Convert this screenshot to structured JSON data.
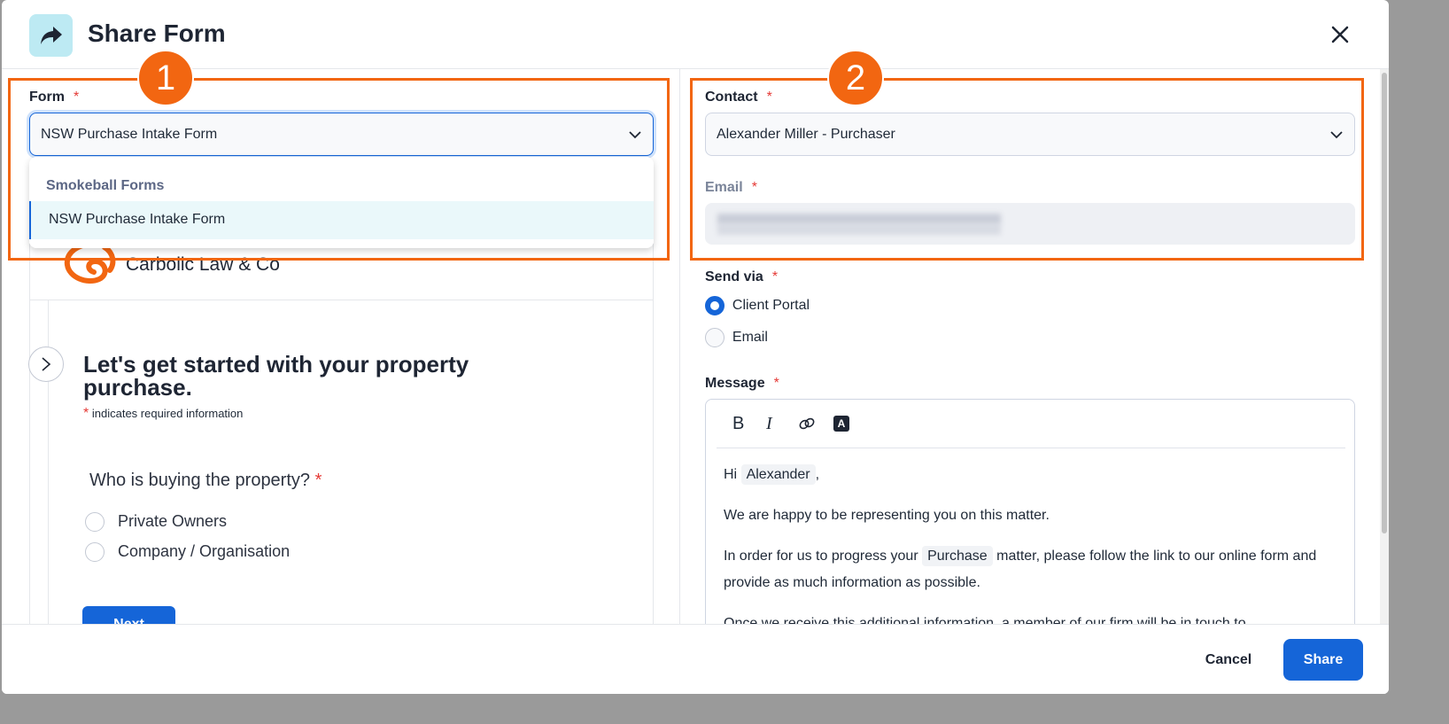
{
  "header": {
    "title": "Share Form",
    "icon": "share-arrow-icon",
    "close_icon": "close-icon"
  },
  "form_field": {
    "label": "Form",
    "required": "*",
    "value": "NSW Purchase Intake Form",
    "dropdown": {
      "group": "Smokeball Forms",
      "options": [
        "NSW Purchase Intake Form"
      ],
      "selected": "NSW Purchase Intake Form"
    }
  },
  "preview": {
    "firm_name": "Carbolic Law & Co",
    "heading": "Let's get started with your property purchase.",
    "required_note": "indicates required information",
    "required_mark": "*",
    "question": "Who is buying the property?",
    "options": [
      "Private Owners",
      "Company / Organisation"
    ],
    "next_label": "Next"
  },
  "contact": {
    "label": "Contact",
    "required": "*",
    "value": "Alexander Miller - Purchaser"
  },
  "email": {
    "label": "Email",
    "required": "*"
  },
  "send_via": {
    "label": "Send via",
    "required": "*",
    "options": [
      {
        "label": "Client Portal",
        "selected": true
      },
      {
        "label": "Email",
        "selected": false
      }
    ]
  },
  "message": {
    "label": "Message",
    "required": "*",
    "toolbar": [
      "bold-icon",
      "italic-icon",
      "link-icon",
      "text-style-icon"
    ],
    "greeting": "Hi",
    "name_chip": "Alexander",
    "comma": ",",
    "p1": "We are happy to be representing you on this matter.",
    "p2_a": "In order for us to progress your",
    "p2_chip": "Purchase",
    "p2_b": "matter, please follow the link to our online form and provide as much information as possible.",
    "p3": "Once we receive this additional information, a member of our firm will be in touch to"
  },
  "footer": {
    "cancel": "Cancel",
    "share": "Share"
  },
  "annotations": {
    "badge1": "1",
    "badge2": "2",
    "color": "#f26611"
  },
  "colors": {
    "primary": "#1565d8",
    "required": "#e53935"
  }
}
